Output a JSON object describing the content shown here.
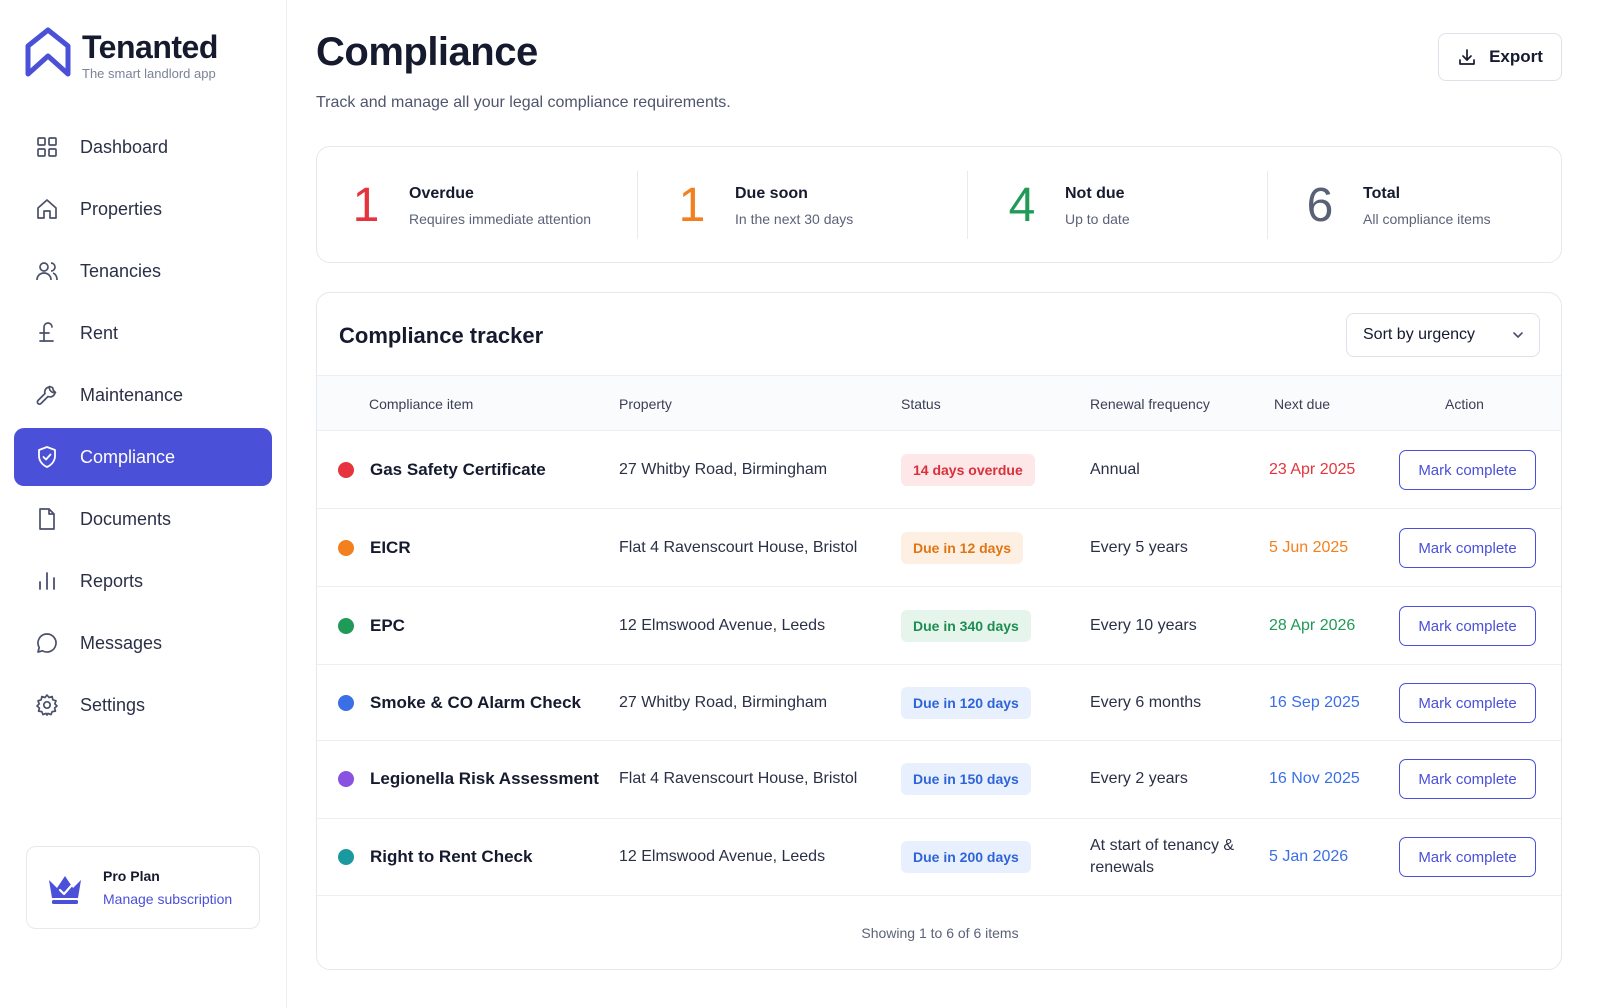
{
  "brand": {
    "name": "Tenanted",
    "tagline": "The smart landlord app"
  },
  "nav": [
    {
      "label": "Dashboard",
      "icon": "dashboard-icon",
      "active": false
    },
    {
      "label": "Properties",
      "icon": "home-icon",
      "active": false
    },
    {
      "label": "Tenancies",
      "icon": "users-icon",
      "active": false
    },
    {
      "label": "Rent",
      "icon": "pound-icon",
      "active": false
    },
    {
      "label": "Maintenance",
      "icon": "wrench-icon",
      "active": false
    },
    {
      "label": "Compliance",
      "icon": "shield-check-icon",
      "active": true
    },
    {
      "label": "Documents",
      "icon": "document-icon",
      "active": false
    },
    {
      "label": "Reports",
      "icon": "bar-chart-icon",
      "active": false
    },
    {
      "label": "Messages",
      "icon": "chat-icon",
      "active": false
    },
    {
      "label": "Settings",
      "icon": "gear-icon",
      "active": false
    }
  ],
  "plan": {
    "title": "Pro Plan",
    "link": "Manage subscription"
  },
  "header": {
    "title": "Compliance",
    "subtitle": "Track and manage all your legal compliance requirements.",
    "export_label": "Export"
  },
  "summary": [
    {
      "value": "1",
      "label": "Overdue",
      "desc": "Requires immediate attention",
      "color": "#e5343d"
    },
    {
      "value": "1",
      "label": "Due soon",
      "desc": "In the next 30 days",
      "color": "#f2801f"
    },
    {
      "value": "4",
      "label": "Not due",
      "desc": "Up to date",
      "color": "#1f9a57"
    },
    {
      "value": "6",
      "label": "Total",
      "desc": "All compliance items",
      "color": "#5a6075"
    }
  ],
  "tracker": {
    "title": "Compliance tracker",
    "sort_label": "Sort by urgency",
    "columns": {
      "item": "Compliance item",
      "property": "Property",
      "status": "Status",
      "frequency": "Renewal frequency",
      "next_due": "Next due",
      "action": "Action"
    },
    "rows": [
      {
        "item": "Gas Safety Certificate",
        "property": "27 Whitby Road, Birmingham",
        "status": "14 days overdue",
        "frequency": "Annual",
        "next_due": "23 Apr 2025",
        "action": "Mark complete",
        "dot": "#e5343d",
        "status_bg": "#fde7e8",
        "status_fg": "#d9303a",
        "due_color": "#e5343d"
      },
      {
        "item": "EICR",
        "property": "Flat 4 Ravenscourt House, Bristol",
        "status": "Due in 12 days",
        "frequency": "Every 5 years",
        "next_due": "5 Jun 2025",
        "action": "Mark complete",
        "dot": "#f2801f",
        "status_bg": "#fdf0e3",
        "status_fg": "#e07514",
        "due_color": "#f2801f"
      },
      {
        "item": "EPC",
        "property": "12 Elmswood Avenue, Leeds",
        "status": "Due in 340 days",
        "frequency": "Every 10 years",
        "next_due": "28 Apr 2026",
        "action": "Mark complete",
        "dot": "#1f9a57",
        "status_bg": "#e5f5ec",
        "status_fg": "#1d8d50",
        "due_color": "#1f9a57"
      },
      {
        "item": "Smoke & CO Alarm Check",
        "property": "27 Whitby Road, Birmingham",
        "status": "Due in 120 days",
        "frequency": "Every 6 months",
        "next_due": "16 Sep 2025",
        "action": "Mark complete",
        "dot": "#3b6fe8",
        "status_bg": "#e8f0fd",
        "status_fg": "#2f64d8",
        "due_color": "#3b6fe8"
      },
      {
        "item": "Legionella Risk Assessment",
        "property": "Flat 4 Ravenscourt House, Bristol",
        "status": "Due in 150 days",
        "frequency": "Every 2 years",
        "next_due": "16 Nov 2025",
        "action": "Mark complete",
        "dot": "#8a52e0",
        "status_bg": "#e8f0fd",
        "status_fg": "#2f64d8",
        "due_color": "#3b6fe8"
      },
      {
        "item": "Right to Rent Check",
        "property": "12 Elmswood Avenue, Leeds",
        "status": "Due in 200 days",
        "frequency": "At start of tenancy & renewals",
        "next_due": "5 Jan 2026",
        "action": "Mark complete",
        "dot": "#1a9aa0",
        "status_bg": "#e8f0fd",
        "status_fg": "#2f64d8",
        "due_color": "#3b6fe8"
      }
    ],
    "footer": "Showing 1 to 6 of 6 items"
  },
  "colors": {
    "accent": "#4a50d8",
    "text": "#161a2e",
    "border": "#e6e8ef"
  }
}
